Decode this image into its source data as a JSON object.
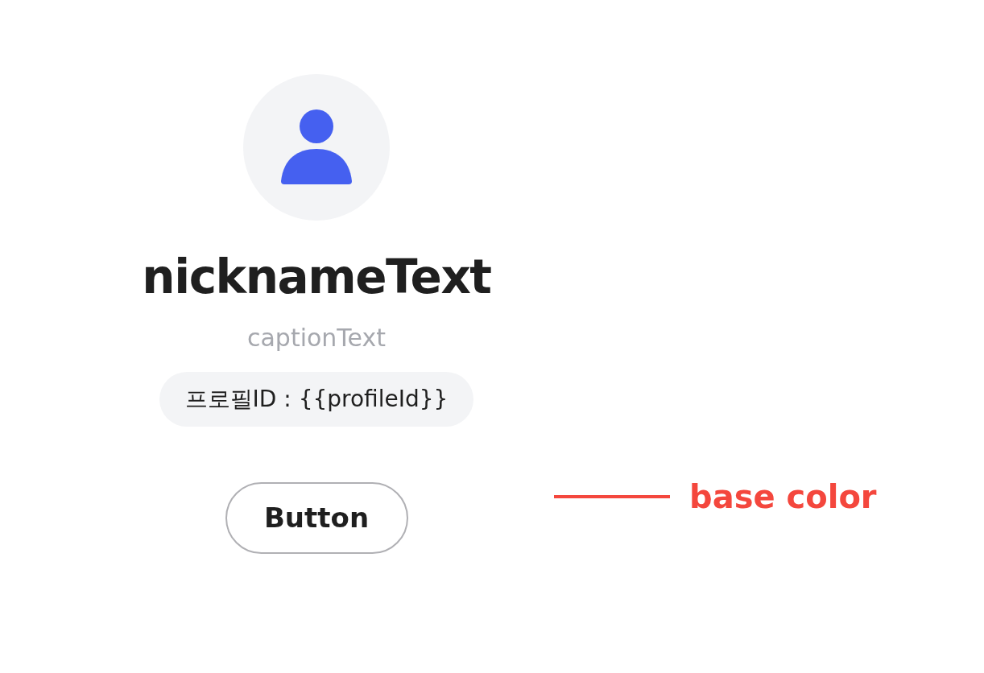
{
  "profile": {
    "nickname": "nicknameText",
    "caption": "captionText",
    "profile_id": "프로필ID : {{profileId}}",
    "button": "Button"
  },
  "annotation": {
    "label": "base color",
    "color": "#f4473d"
  }
}
